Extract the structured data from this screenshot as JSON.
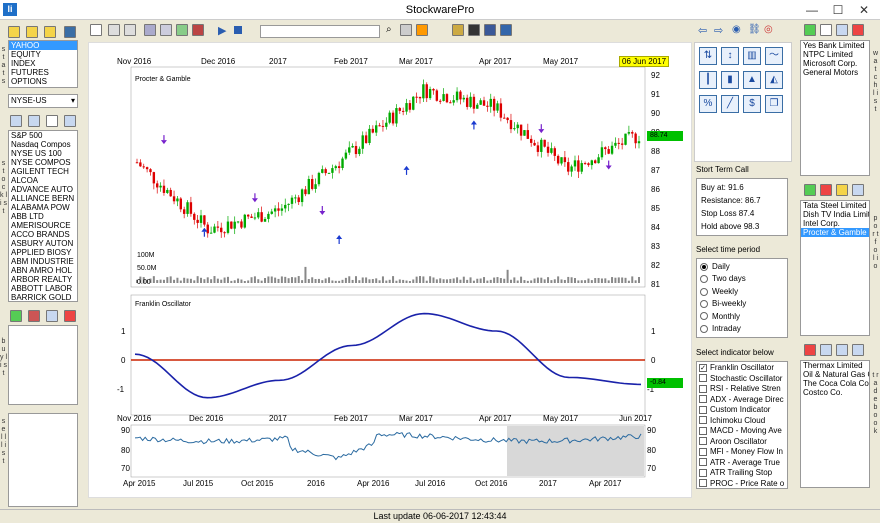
{
  "window": {
    "title": "StockwarePro",
    "minimize": "—",
    "maximize": "☐",
    "close": "✕"
  },
  "left": {
    "exchanges": [
      "YAHOO",
      "EQUITY",
      "INDEX",
      "FUTURES",
      "OPTIONS"
    ],
    "market_select": "NYSE-US",
    "stocks": [
      "S&P 500",
      "Nasdaq Compos",
      "NYSE US 100",
      "NYSE COMPOS",
      "AGILENT TECH",
      "ALCOA",
      "ADVANCE AUTO",
      "ALLIANCE BERN",
      "ALABAMA POW",
      "ABB LTD",
      "AMERISOURCE",
      "ACCO BRANDS",
      "ASBURY AUTON",
      "APPLIED BIOSY",
      "ABM INDUSTRIE",
      "ABN AMRO HOL",
      "ARBOR REALTY",
      "ABBOTT LABOR",
      "BARRICK GOLD"
    ],
    "stats_label": "s t a t s",
    "stock_list_label": "s t o c k l i s t",
    "buy_list_label": "b u y l i s t",
    "sell_list_label": "s e l l l i s t"
  },
  "chart": {
    "top_axis": [
      "Nov 2016",
      "Dec 2016",
      "2017",
      "Feb 2017",
      "Mar 2017",
      "Apr 2017",
      "May 2017"
    ],
    "date_badge": "06 Jun 2017",
    "stock_name": "Procter & Gamble",
    "price_ticks": [
      "92",
      "91",
      "90",
      "89",
      "88",
      "87",
      "86",
      "85",
      "84",
      "83",
      "82",
      "81"
    ],
    "price_badge": "88.74",
    "volume_labels": [
      "100M",
      "50.0M",
      "0.00"
    ],
    "osc_title": "Franklin Oscillator",
    "osc_ticks": [
      "1",
      "0",
      "-1"
    ],
    "osc_badge": "-0.84",
    "mid_axis": [
      "Nov 2016",
      "Dec 2016",
      "2017",
      "Feb 2017",
      "Mar 2017",
      "Apr 2017",
      "May 2017",
      "Jun 2017"
    ],
    "overview_ticks": [
      "90",
      "80",
      "70"
    ],
    "bottom_axis": [
      "Apr 2015",
      "Jul 2015",
      "Oct 2015",
      "2016",
      "Apr 2016",
      "Jul 2016",
      "Oct 2016",
      "2017",
      "Apr 2017"
    ]
  },
  "chart_data": [
    {
      "type": "line",
      "title": "Procter & Gamble",
      "x": [
        "Nov 2016",
        "Dec 2016",
        "2017",
        "Feb 2017",
        "Mar 2017",
        "Apr 2017",
        "May 2017",
        "Jun 2017"
      ],
      "series": [
        {
          "values": [
            87.2,
            83.5,
            84.6,
            87.8,
            91.2,
            90.2,
            86.8,
            88.7
          ]
        }
      ],
      "ylim": [
        81,
        92
      ]
    },
    {
      "type": "line",
      "title": "Franklin Oscillator",
      "x": [
        "Nov 2016",
        "Dec 2016",
        "2017",
        "Feb 2017",
        "Mar 2017",
        "Apr 2017",
        "May 2017",
        "Jun 2017"
      ],
      "series": [
        {
          "values": [
            0.2,
            -1.3,
            -0.7,
            0.5,
            1.6,
            1.0,
            -0.6,
            -0.84
          ]
        }
      ],
      "ylim": [
        -1.5,
        1.7
      ]
    }
  ],
  "right": {
    "short_term_title": "Stort Term Call",
    "calls": [
      "Buy at: 91.6",
      "Resistance: 86.7",
      "Stop Loss 87.4",
      "Hold above 98.3"
    ],
    "time_title": "Select time period",
    "periods": [
      "Daily",
      "Two days",
      "Weekly",
      "Bi-weekly",
      "Monthly",
      "Intraday"
    ],
    "indicator_title": "Select indicator below",
    "indicators": [
      "Franklin Oscillator",
      "Stochastic Oscillator",
      "RSI - Relative Stren",
      "ADX - Average Direc",
      "Custom Indicator",
      "Ichimoku Cloud",
      "MACD - Moving Ave",
      "Aroon Oscillator",
      "MFI - Money Flow In",
      "ATR - Average True",
      "ATR Trailing Stop",
      "PROC - Price Rate o"
    ]
  },
  "far_right": {
    "watch_list": [
      "Yes Bank Limited",
      "NTPC Limited",
      "Microsoft Corp.",
      "General Motors"
    ],
    "watch_label": "w a t c h l i s t",
    "portfolio": [
      "Tata Steel Limited",
      "Dish TV India Limited",
      "Intel Corp.",
      "Procter & Gamble"
    ],
    "portfolio_label": "p o r t f o l i o",
    "trade_book": [
      "Thermax Limited",
      "Oil & Natural Gas Cor",
      "The Coca Cola Comp",
      "Costco Co."
    ],
    "trade_label": "t r a d e b o o k"
  },
  "status": {
    "text": "Last update 06-06-2017 12:43:44"
  }
}
